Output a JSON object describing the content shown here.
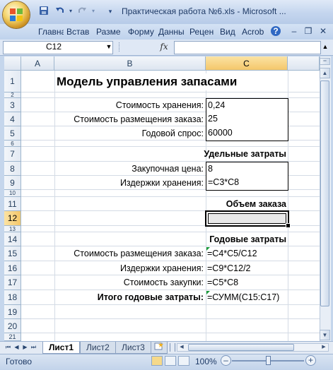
{
  "window": {
    "title": "Практическая работа №6.xls - Microsoft ...",
    "minimize_label": "–",
    "restore_label": "❐",
    "close_label": "✕"
  },
  "quick_access": {
    "save_icon": "save-icon",
    "undo_icon": "undo-icon",
    "redo_icon": "redo-icon",
    "customize_icon": "dropdown-arrow-icon"
  },
  "ribbon": {
    "tabs": [
      "Главна",
      "Встав",
      "Разме",
      "Форму",
      "Данны",
      "Рецен",
      "Вид",
      "Acrob"
    ],
    "help_label": "?",
    "min_label": "–",
    "restore_label": "❐",
    "close_label": "✕"
  },
  "formula_bar": {
    "name_box": "C12",
    "fx_label": "fx",
    "formula": ""
  },
  "sheet": {
    "columns": [
      "A",
      "B",
      "C"
    ],
    "rows": [
      "1",
      "2",
      "3",
      "4",
      "5",
      "6",
      "7",
      "8",
      "9",
      "10",
      "11",
      "12",
      "13",
      "14",
      "15",
      "16",
      "17",
      "18",
      "19",
      "20",
      "21"
    ],
    "selected_cell": "C12",
    "cells": {
      "title": "Модель управления запасами",
      "b3": "Стоимость хранения:",
      "c3": "0,24",
      "b4": "Стоимость размещения заказа:",
      "c4": "25",
      "b5": "Годовой спрос:",
      "c5": "60000",
      "c7": "Удельные затраты",
      "b8": "Закупочная цена:",
      "c8": "8",
      "b9": "Издержки хранения:",
      "c9": "=C3*C8",
      "c11": "Объем заказа",
      "c12": "",
      "c14": "Годовые затраты",
      "b15": "Стоимость размещения заказа:",
      "c15": "=C4*C5/C12",
      "b16": "Издержки хранения:",
      "c16": "=C9*C12/2",
      "b17": "Стоимость закупки:",
      "c17": "=C5*C8",
      "b18": "Итого годовые затраты:",
      "c18": "=СУММ(C15:C17)"
    }
  },
  "sheet_tabs": {
    "tabs": [
      "Лист1",
      "Лист2",
      "Лист3"
    ],
    "active": "Лист1"
  },
  "status_bar": {
    "status": "Готово",
    "zoom": "100%",
    "zoom_out": "–",
    "zoom_in": "+"
  }
}
